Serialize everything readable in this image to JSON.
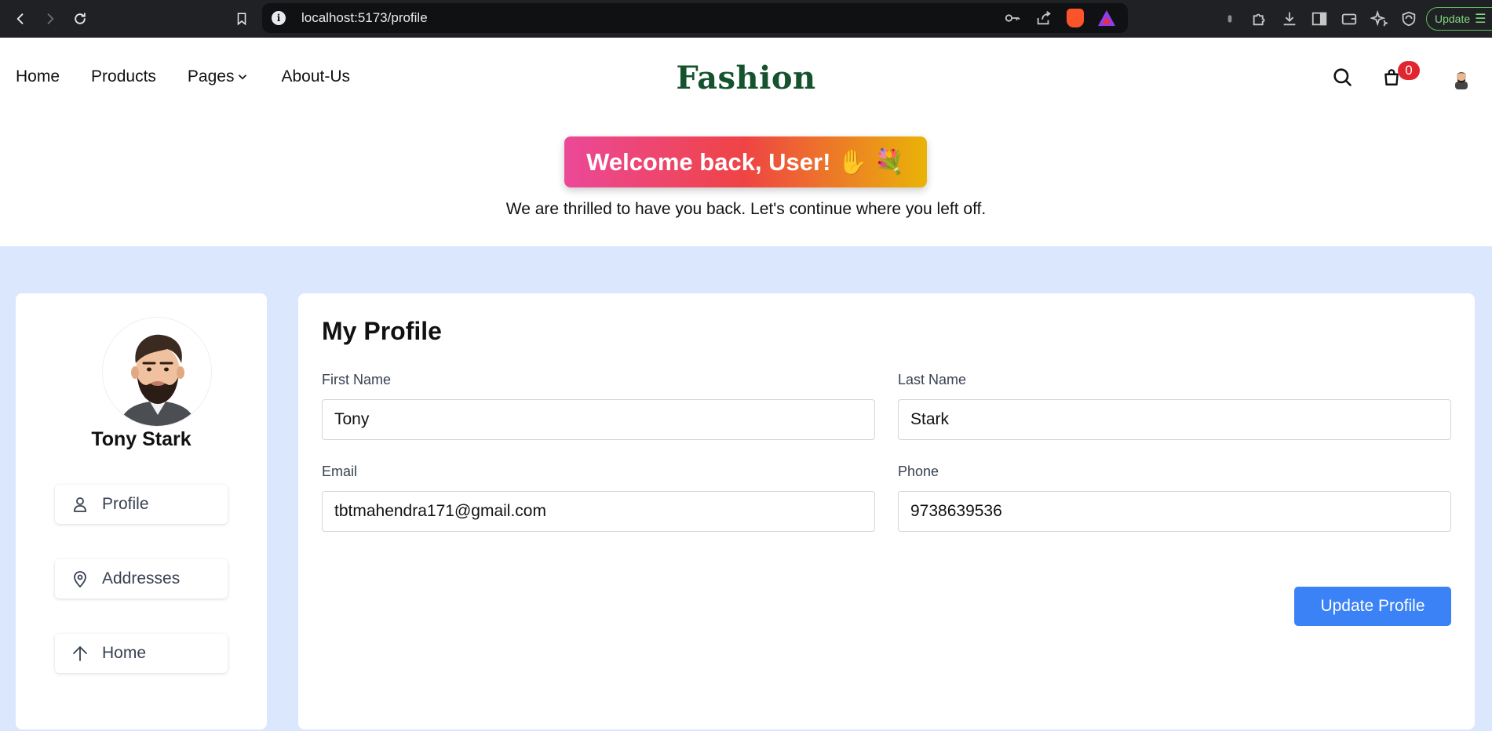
{
  "browser": {
    "url": "localhost:5173/profile",
    "update_label": "Update"
  },
  "site": {
    "brand": "Fashion",
    "nav": [
      {
        "label": "Home"
      },
      {
        "label": "Products"
      },
      {
        "label": "Pages"
      },
      {
        "label": "About-Us"
      }
    ],
    "cart_count": "0"
  },
  "welcome": {
    "title": "Welcome back, User! ✋ 💐",
    "subtitle": "We are thrilled to have you back. Let's continue where you left off."
  },
  "sidebar": {
    "user_name": "Tony Stark",
    "items": [
      {
        "label": "Profile",
        "icon": "user-icon"
      },
      {
        "label": "Addresses",
        "icon": "map-pin-icon"
      },
      {
        "label": "Home",
        "icon": "arrow-up-icon"
      }
    ]
  },
  "profile": {
    "title": "My Profile",
    "fields": {
      "first_name": {
        "label": "First Name",
        "value": "Tony"
      },
      "last_name": {
        "label": "Last Name",
        "value": "Stark"
      },
      "email": {
        "label": "Email",
        "value": "tbtmahendra171@gmail.com"
      },
      "phone": {
        "label": "Phone",
        "value": "9738639536"
      }
    },
    "submit_label": "Update Profile"
  },
  "colors": {
    "brand": "#14532d",
    "page_bg": "#dbe7fd",
    "primary_button": "#3b82f6",
    "badge": "#e0262f"
  }
}
